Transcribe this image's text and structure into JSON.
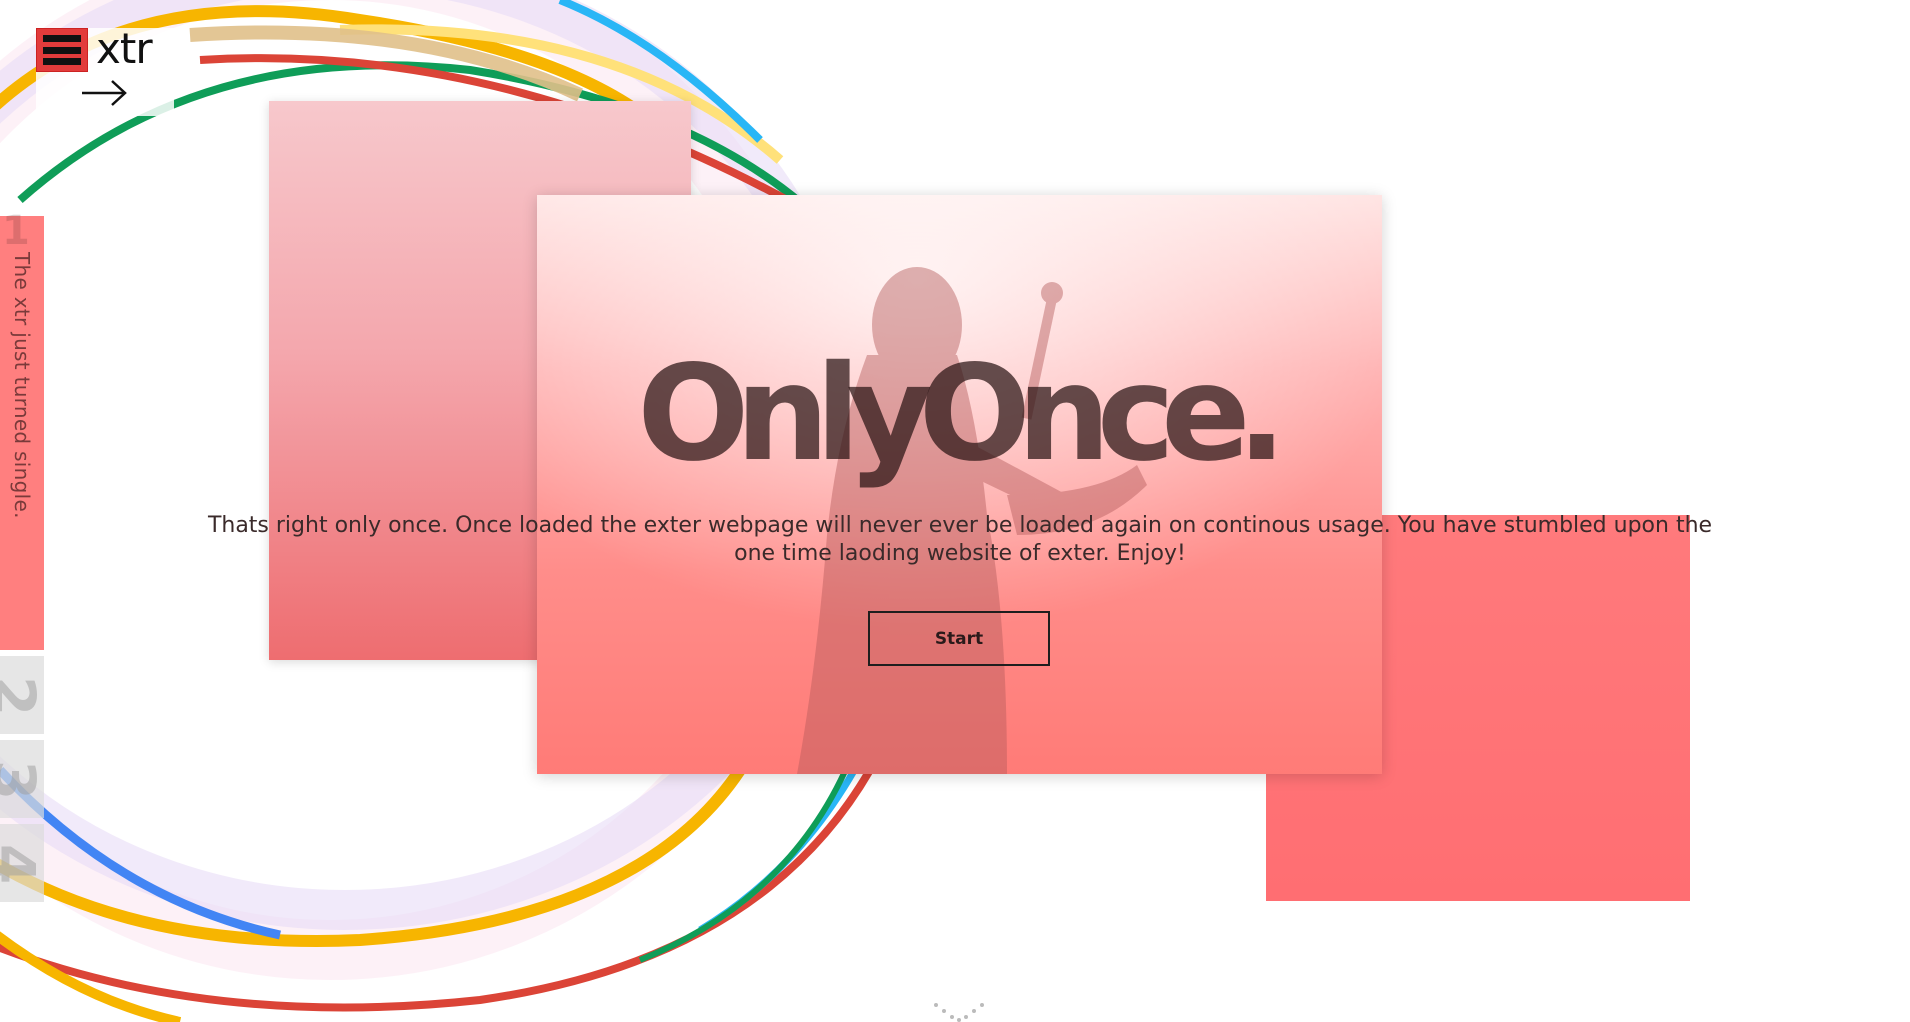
{
  "logo": {
    "text": "xtr"
  },
  "sidebar": {
    "active_tab": {
      "number": "1",
      "label": "The xtr just turned single."
    },
    "tabs": [
      {
        "number": "2"
      },
      {
        "number": "3"
      },
      {
        "number": "4"
      }
    ]
  },
  "hero": {
    "title": "OnlyOnce.",
    "description": "Thats right only once. Once loaded the exter webpage will never ever be loaded again on continous usage. You have stumbled upon the one time laoding website of exter. Enjoy!",
    "start_label": "Start"
  },
  "icons": {
    "menu": "hamburger-menu-icon",
    "arrow": "arrow-right-icon",
    "scroll": "chevron-down-icon"
  },
  "colors": {
    "brand_red": "#e23b3b",
    "card_coral": "#ff7f7f",
    "text_dark": "#1e1e1e"
  }
}
